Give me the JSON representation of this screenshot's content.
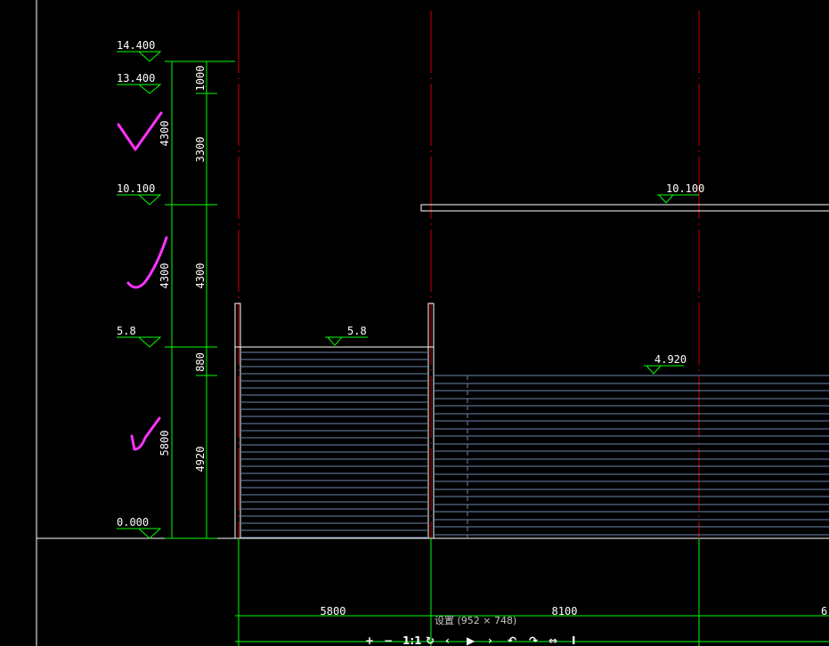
{
  "colors": {
    "background": "#000000",
    "dimension_line": "#00ff00",
    "axis_line": "#cc0000",
    "outline": "#ffffff",
    "hatch": "#6f86ad",
    "check_mark": "#ff33ff"
  },
  "levels": {
    "l14400": "14.400",
    "l13400": "13.400",
    "l10100_left": "10.100",
    "l10100_right": "10.100",
    "l5800_left": "5.8",
    "l5800_mid": "5.8",
    "l4920": "4.920",
    "l0000": "0.000"
  },
  "vertical_dims": {
    "outer": [
      "4300",
      "4300",
      "5800"
    ],
    "inner": [
      "1000",
      "3300",
      "4300",
      "880",
      "4920"
    ]
  },
  "horizontal_dims": [
    "5800",
    "8100",
    "6"
  ],
  "check_marks": [
    "check-mark-icon",
    "check-mark-icon",
    "check-mark-icon"
  ],
  "statusbar": {
    "caption": "设置 (952 × 748)",
    "tools": [
      "+",
      "−",
      "1:1",
      "↻",
      "‹",
      "▶",
      "›",
      "↶",
      "↷",
      "⇔",
      "I"
    ]
  }
}
